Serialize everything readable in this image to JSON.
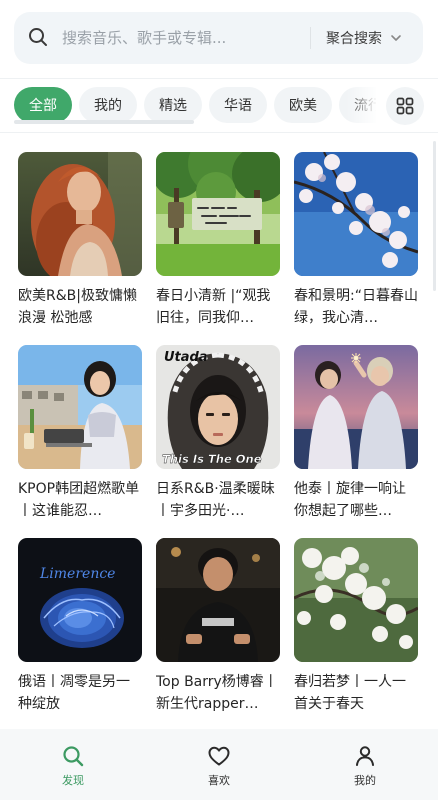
{
  "search": {
    "placeholder": "搜索音乐、歌手或专辑...",
    "mode_label": "聚合搜索"
  },
  "tabs": [
    "全部",
    "我的",
    "精选",
    "华语",
    "欧美",
    "流行"
  ],
  "active_tab": 0,
  "playlists": [
    {
      "title": "欧美R&B|极致慵懒 浪漫 松弛感",
      "cover": "portrait-red-hair"
    },
    {
      "title": "春日小清新 |“观我旧往，同我仰…",
      "cover": "park-tree-sign"
    },
    {
      "title": "春和景明:“日暮春山绿，我心清…",
      "cover": "blossom-blue-sky"
    },
    {
      "title": "KPOP韩团超燃歌单丨这谁能忍…",
      "cover": "girl-with-laptop"
    },
    {
      "title": "日系R&B·温柔暖昧丨宇多田光·…",
      "cover": "utada-album",
      "cover_text": {
        "top": "Utada",
        "bottom": "This Is The One"
      }
    },
    {
      "title": "他泰丨旋律一响让你想起了哪些…",
      "cover": "two-people-sunset"
    },
    {
      "title": "俄语丨凋零是另一种绽放",
      "cover": "blue-rose",
      "cover_text": {
        "script": "Limerence"
      }
    },
    {
      "title": "Top Barry杨博睿丨新生代rapper…",
      "cover": "man-night-street"
    },
    {
      "title": "春归若梦丨一人一首关于春天",
      "cover": "white-blossoms"
    }
  ],
  "nav": [
    {
      "label": "发现",
      "icon": "search-icon",
      "active": true
    },
    {
      "label": "喜欢",
      "icon": "heart-icon",
      "active": false
    },
    {
      "label": "我的",
      "icon": "person-icon",
      "active": false
    }
  ],
  "colors": {
    "accent": "#40a86a",
    "nav_active": "#3c9a62",
    "search_bg": "#f1f5f8",
    "tab_bg": "#f1f4f6"
  }
}
